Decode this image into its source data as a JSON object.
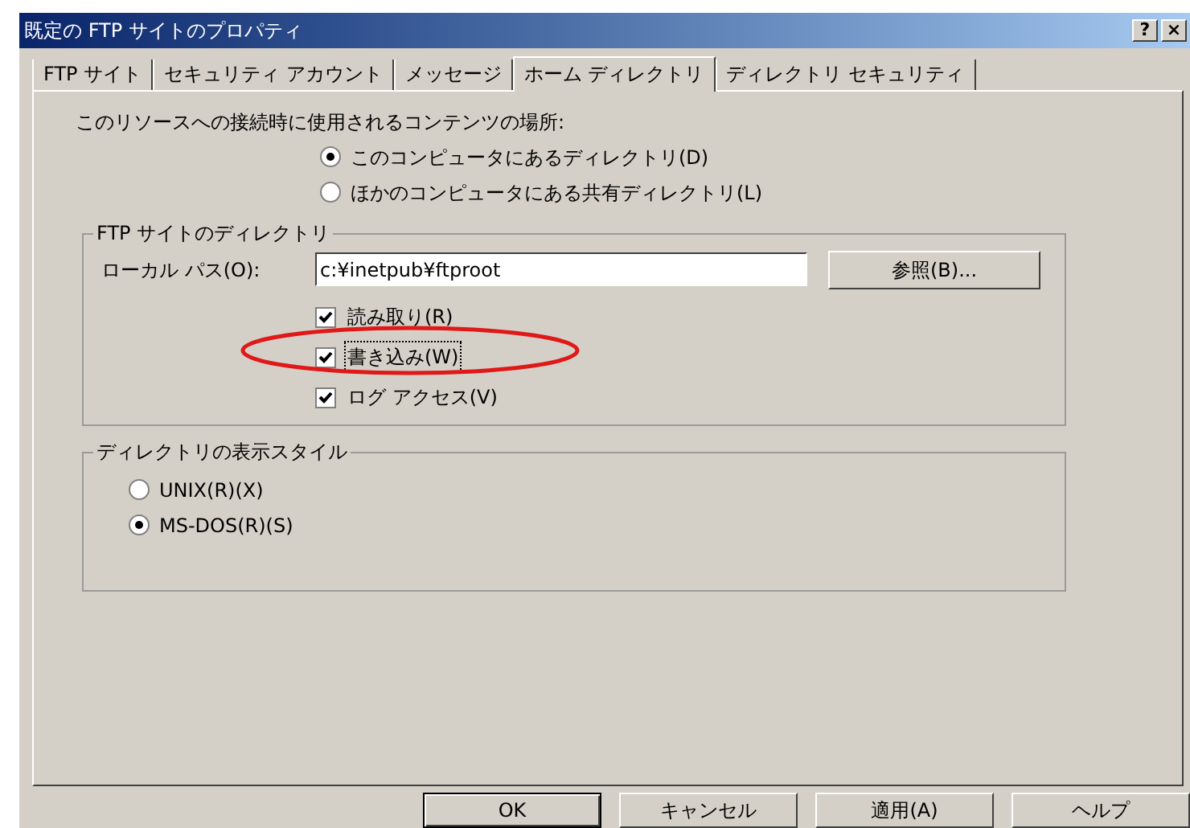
{
  "window": {
    "title": "既定の FTP サイトのプロパティ",
    "title_buttons": [
      "?",
      "×"
    ]
  },
  "tabs": [
    {
      "label": "FTP サイト",
      "selected": false
    },
    {
      "label": "セキュリティ アカウント",
      "selected": false
    },
    {
      "label": "メッセージ",
      "selected": false
    },
    {
      "label": "ホーム ディレクトリ",
      "selected": true
    },
    {
      "label": "ディレクトリ セキュリティ",
      "selected": false
    }
  ],
  "content_location": {
    "label": "このリソースへの接続時に使用されるコンテンツの場所:",
    "options": [
      {
        "label": "このコンピュータにあるディレクトリ(D)",
        "selected": true
      },
      {
        "label": "ほかのコンピュータにある共有ディレクトリ(L)",
        "selected": false
      }
    ]
  },
  "ftp_directory": {
    "title": "FTP サイトのディレクトリ",
    "local_path": {
      "label": "ローカル パス(O):",
      "value": "c:¥inetpub¥ftproot"
    },
    "browse_button": "参照(B)...",
    "permissions": [
      {
        "label": "読み取り(R)",
        "checked": true,
        "focused": false
      },
      {
        "label": "書き込み(W)",
        "checked": true,
        "focused": true
      },
      {
        "label": "ログ アクセス(V)",
        "checked": true,
        "focused": false
      }
    ]
  },
  "listing_style": {
    "title": "ディレクトリの表示スタイル",
    "options": [
      {
        "label": "UNIX(R)(X)",
        "selected": false
      },
      {
        "label": "MS-DOS(R)(S)",
        "selected": true
      }
    ]
  },
  "buttons": [
    {
      "label": "OK",
      "default": true
    },
    {
      "label": "キャンセル",
      "default": false
    },
    {
      "label": "適用(A)",
      "default": false
    },
    {
      "label": "ヘルプ",
      "default": false
    }
  ]
}
